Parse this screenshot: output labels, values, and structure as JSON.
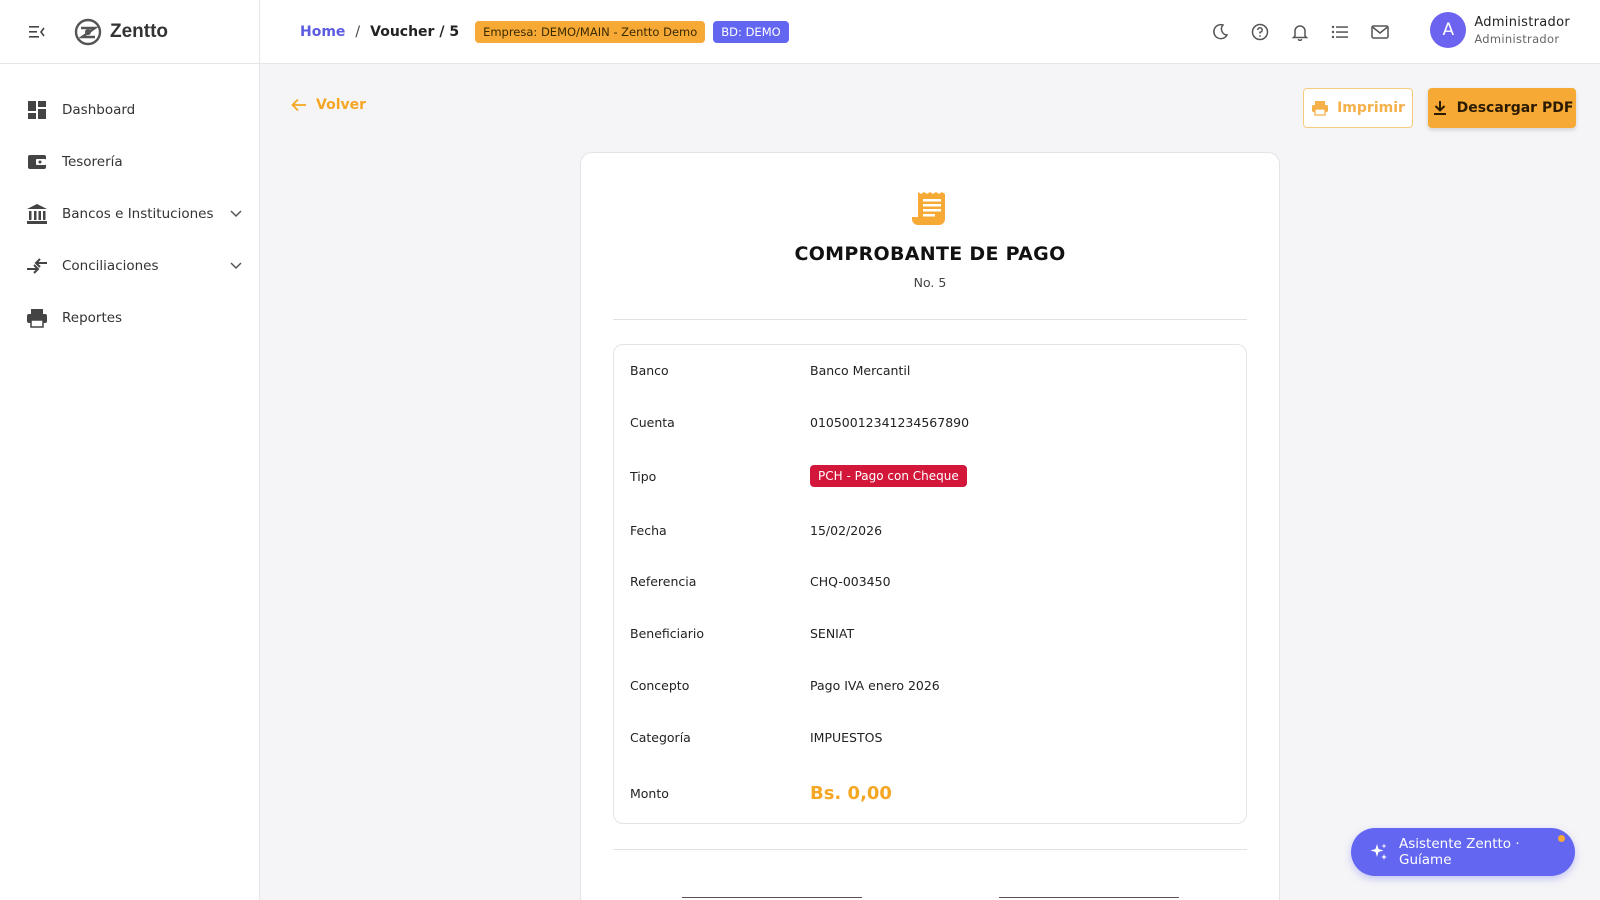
{
  "brand": {
    "name": "Zentto"
  },
  "sidebar": {
    "items": [
      {
        "label": "Dashboard",
        "icon": "dashboard-icon",
        "expandable": false
      },
      {
        "label": "Tesorería",
        "icon": "wallet-icon",
        "expandable": false
      },
      {
        "label": "Bancos e Instituciones",
        "icon": "bank-icon",
        "expandable": true
      },
      {
        "label": "Conciliaciones",
        "icon": "compare-arrows-icon",
        "expandable": true
      },
      {
        "label": "Reportes",
        "icon": "print-icon",
        "expandable": false
      }
    ]
  },
  "topbar": {
    "breadcrumb": {
      "home": "Home",
      "separator": "/",
      "current": "Voucher / 5"
    },
    "empresa_badge": "Empresa: DEMO/MAIN - Zentto Demo",
    "bd_badge": "BD: DEMO",
    "icons": [
      "moon-icon",
      "help-icon",
      "bell-icon",
      "list-icon",
      "mail-icon"
    ],
    "user": {
      "initial": "A",
      "name": "Administrador",
      "role": "Administrador"
    }
  },
  "page": {
    "back_label": "Volver",
    "print_label": "Imprimir",
    "pdf_label": "Descargar PDF"
  },
  "voucher": {
    "title": "COMPROBANTE DE PAGO",
    "number": "No. 5",
    "fields": {
      "banco": {
        "label": "Banco",
        "value": "Banco Mercantil"
      },
      "cuenta": {
        "label": "Cuenta",
        "value": "01050012341234567890"
      },
      "tipo": {
        "label": "Tipo",
        "value": "PCH - Pago con Cheque"
      },
      "fecha": {
        "label": "Fecha",
        "value": "15/02/2026"
      },
      "referencia": {
        "label": "Referencia",
        "value": "CHQ-003450"
      },
      "beneficiario": {
        "label": "Beneficiario",
        "value": "SENIAT"
      },
      "concepto": {
        "label": "Concepto",
        "value": "Pago IVA enero 2026"
      },
      "categoria": {
        "label": "Categoría",
        "value": "IMPUESTOS"
      },
      "monto": {
        "label": "Monto",
        "value": "Bs. 0,00"
      }
    }
  },
  "assistant": {
    "label": "Asistente Zentto · Guíame"
  },
  "colors": {
    "accent": "#f7a935",
    "primary": "#6366f1",
    "tipo_chip": "#d2173a"
  }
}
